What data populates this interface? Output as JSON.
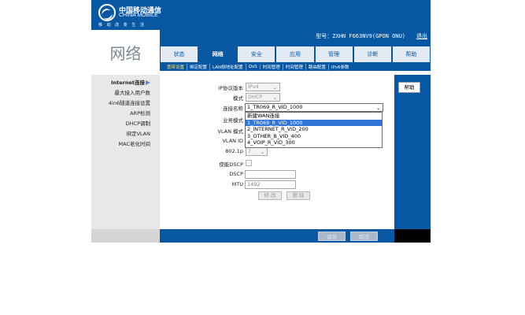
{
  "brand": {
    "name_cn": "中国移动通信",
    "name_en": "CHINA MOBILE",
    "slogan": "移 动 改 变 生 活"
  },
  "section_title": "网络",
  "header": {
    "model_text": "型号：ZXHN F663NV9(GPON ONU)",
    "logout_label": "退出"
  },
  "tabs": [
    {
      "label": "状态"
    },
    {
      "label": "网络"
    },
    {
      "label": "安全"
    },
    {
      "label": "应用"
    },
    {
      "label": "管理"
    },
    {
      "label": "诊断"
    },
    {
      "label": "帮助"
    }
  ],
  "subnav": [
    {
      "label": "宽带设置"
    },
    {
      "label": "绑定配置"
    },
    {
      "label": "LAN侧地址配置"
    },
    {
      "label": "QoS"
    },
    {
      "label": "时间管理"
    },
    {
      "label": "时间管理"
    },
    {
      "label": "路由配置"
    },
    {
      "label": "IPv6参数"
    }
  ],
  "left_menu": [
    {
      "label": "Internet连接"
    },
    {
      "label": "最大接入用户数"
    },
    {
      "label": "4in6隧道连接设置"
    },
    {
      "label": "ARP检测"
    },
    {
      "label": "DHCP调制"
    },
    {
      "label": "绑定VLAN"
    },
    {
      "label": "MAC老化时间"
    }
  ],
  "form": {
    "ip_protocol_label": "IP协议版本",
    "ip_protocol_value": "IPv4",
    "mode_label": "模式",
    "mode_value": "DHCP",
    "conn_name_label": "连接名称",
    "conn_name_value": "1_TR069_R_VID_1000",
    "service_mode_label": "业务模式",
    "vlan_mode_label": "VLAN 模式",
    "vlan_id_label": "VLAN ID",
    "dot1p_label": "802.1p",
    "dot1p_value": "7",
    "dscp_enable_label": "使能DSCP",
    "dscp_label": "DSCP",
    "mtu_label": "MTU",
    "mtu_value": "1492",
    "btn_modify": "修 改",
    "btn_delete": "删 除"
  },
  "dropdown_options": [
    {
      "label": "新建WAN连接"
    },
    {
      "label": "1_TR069_R_VID_1000"
    },
    {
      "label": "2_INTERNET_R_VID_200"
    },
    {
      "label": "3_OTHER_B_VID_400"
    },
    {
      "label": "4_VOIP_R_VID_300"
    }
  ],
  "help_label": "帮助",
  "bottom": {
    "save_label": "保存",
    "cancel_label": "取消"
  }
}
